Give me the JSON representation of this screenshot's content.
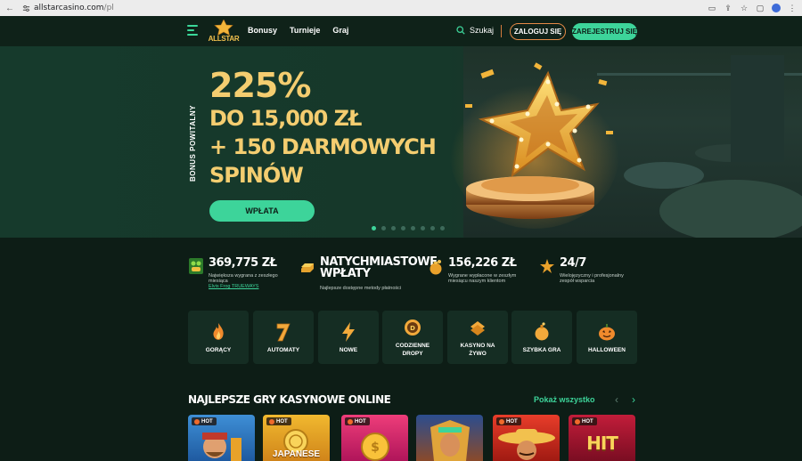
{
  "browser": {
    "url_host": "allstarcasino.com",
    "url_path": "/pl"
  },
  "header": {
    "logo_text": "ALLSTAR",
    "nav": [
      "Bonusy",
      "Turnieje",
      "Graj"
    ],
    "search_label": "Szukaj",
    "login_label": "ZALOGUJ SIĘ",
    "register_label": "ZAREJESTRUJ SIĘ"
  },
  "hero": {
    "vertical_label": "BONUS POWITALNY",
    "line1": "225%",
    "line2": "DO 15,000 ZŁ",
    "line3": "+ 150 DARMOWYCH",
    "line4": "SPINÓW",
    "cta_label": "WPŁATA",
    "slides": 8,
    "active_slide": 0
  },
  "stats": [
    {
      "value": "369,775 ZŁ",
      "desc1": "Największa wygrana z zeszłego",
      "desc2": "miesiąca",
      "link": "Elvis Frog TRUEWAYS",
      "icon": "frog-icon"
    },
    {
      "value": "NATYCHMIASTOWE",
      "value2": "WPŁATY",
      "desc1": "Najlepsze dostępne metody płatności",
      "icon": "gold-bar-icon"
    },
    {
      "value": "156,226 ZŁ",
      "desc1": "Wygrane wypłacone w zeszłym",
      "desc2": "miesiącu naszym klientom",
      "icon": "money-bag-icon"
    },
    {
      "value": "24/7",
      "desc1": "Wielojęzyczny i profesjonalny",
      "desc2": "zespół wsparcia",
      "icon": "support-icon"
    }
  ],
  "categories": [
    {
      "label1": "GORĄCY",
      "label2": "",
      "icon": "flame-icon"
    },
    {
      "label1": "AUTOMATY",
      "label2": "",
      "icon": "seven-icon"
    },
    {
      "label1": "NOWE",
      "label2": "",
      "icon": "lightning-icon"
    },
    {
      "label1": "CODZIENNE",
      "label2": "DROPY",
      "icon": "drops-icon"
    },
    {
      "label1": "KASYNO NA",
      "label2": "ŻYWO",
      "icon": "chips-icon"
    },
    {
      "label1": "SZYBKA GRA",
      "label2": "",
      "icon": "bomb-icon"
    },
    {
      "label1": "HALLOWEEN",
      "label2": "",
      "icon": "pumpkin-icon"
    }
  ],
  "games_section": {
    "title": "NAJLEPSZE GRY KASYNOWE ONLINE",
    "show_all": "Pokaż wszystko",
    "prev": "‹",
    "next": "›",
    "hot_label": "HOT",
    "games": [
      {
        "text": ""
      },
      {
        "text": "JAPANESE"
      },
      {
        "text": ""
      },
      {
        "text": ""
      },
      {
        "text": ""
      },
      {
        "text": "HIT"
      }
    ]
  },
  "colors": {
    "accent_green": "#3dd49a",
    "gold": "#f4cd70",
    "orange": "#e58a47"
  }
}
